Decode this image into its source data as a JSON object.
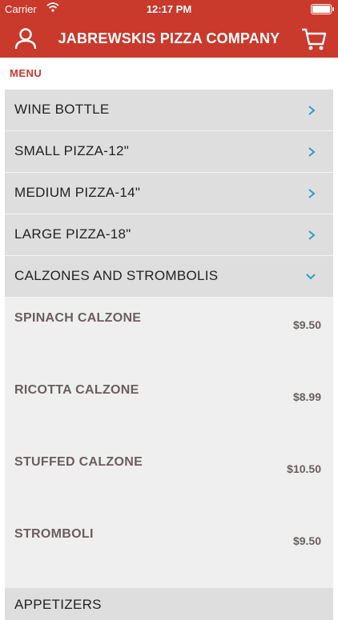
{
  "status_bar": {
    "carrier": "Carrier",
    "time": "12:17 PM"
  },
  "header": {
    "title": "JABREWSKIS PIZZA COMPANY",
    "user_icon": "user-icon",
    "cart_icon": "cart-icon",
    "background": "#c9392c"
  },
  "menu": {
    "section_label": "MENU",
    "categories": [
      {
        "label": "WINE BOTTLE",
        "state": "collapsed"
      },
      {
        "label": "SMALL PIZZA-12\"",
        "state": "collapsed"
      },
      {
        "label": "MEDIUM PIZZA-14\"",
        "state": "collapsed"
      },
      {
        "label": "LARGE PIZZA-18\"",
        "state": "collapsed"
      },
      {
        "label": "CALZONES AND STROMBOLIS",
        "state": "expanded"
      }
    ],
    "expanded_items": [
      {
        "name": "SPINACH CALZONE",
        "price": "$9.50"
      },
      {
        "name": "RICOTTA CALZONE",
        "price": "$8.99"
      },
      {
        "name": "STUFFED CALZONE",
        "price": "$10.50"
      },
      {
        "name": "STROMBOLI",
        "price": "$9.50"
      }
    ],
    "next_category": {
      "label": "APPETIZERS"
    }
  }
}
